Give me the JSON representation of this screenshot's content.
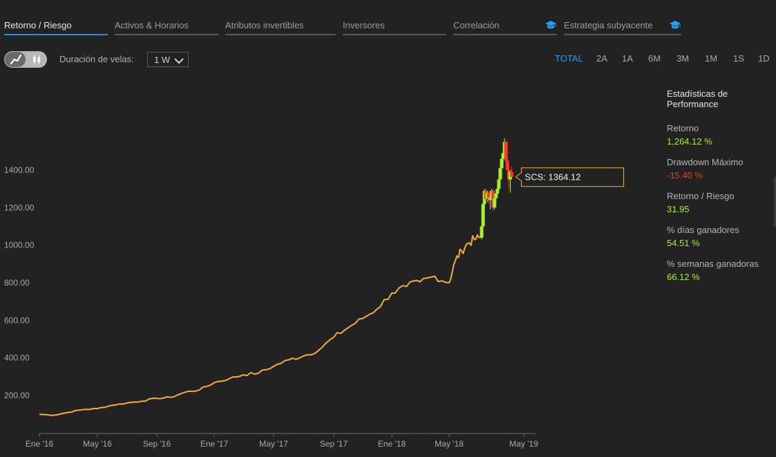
{
  "tabs": [
    {
      "label": "Retorno / Riesgo",
      "active": true
    },
    {
      "label": "Activos & Horarios"
    },
    {
      "label": "Atributos invertibles"
    },
    {
      "label": "Inversores"
    },
    {
      "label": "Correlación",
      "icon": "graduation-cap-icon"
    },
    {
      "label": "Estrategia subyacente",
      "icon": "graduation-cap-icon"
    }
  ],
  "toolbar": {
    "chart_toggle": {
      "options": [
        "line-chart-icon",
        "candlestick-icon"
      ],
      "selected": "line-chart-icon"
    },
    "duration_label": "Duración de velas:",
    "duration_value": "1 W",
    "ranges": [
      "TOTAL",
      "2A",
      "1A",
      "6M",
      "3M",
      "1M",
      "1S",
      "1D"
    ],
    "active_range": "TOTAL"
  },
  "colors": {
    "background": "#222222",
    "line": "#f5ad38",
    "candle_up": "#a6f02c",
    "candle_down": "#f23c2c",
    "tooltip_border": "#e8b84a",
    "active_tab": "#1e90e0"
  },
  "tooltip": {
    "label": "SCS: 1364.12"
  },
  "stats": {
    "title": "Estadísticas de Performance",
    "items": [
      {
        "label": "Retorno",
        "value": "1,264.12 %",
        "sign": "pos"
      },
      {
        "label": "Drawdown Máximo",
        "value": "-15.40 %",
        "sign": "neg"
      },
      {
        "label": "Retorno / Riesgo",
        "value": "31.95",
        "sign": "pos"
      },
      {
        "label": "% días ganadores",
        "value": "54.51 %",
        "sign": "pos"
      },
      {
        "label": "% semanas ganadoras",
        "value": "66.12 %",
        "sign": "pos"
      }
    ]
  },
  "chart_data": {
    "type": "line",
    "series_label": "SCS",
    "x_ticks": [
      "Ene '16",
      "May '16",
      "Sep '16",
      "Ene '17",
      "May '17",
      "Sep '17",
      "Ene '18",
      "May '18",
      "May '19"
    ],
    "y_ticks": [
      200,
      400,
      600,
      800,
      1000,
      1200,
      1400
    ],
    "y_tick_labels": [
      "200.00",
      "400.00",
      "600.00",
      "800.00",
      "1000.00",
      "1200.00",
      "1400.00"
    ],
    "ylim": [
      50,
      1600
    ],
    "xlim": [
      "2016-01-01",
      "2019-06-01"
    ],
    "line_points": [
      [
        "2016-01-01",
        100
      ],
      [
        "2016-02-01",
        95
      ],
      [
        "2016-03-01",
        110
      ],
      [
        "2016-04-01",
        125
      ],
      [
        "2016-05-01",
        130
      ],
      [
        "2016-06-01",
        148
      ],
      [
        "2016-07-01",
        160
      ],
      [
        "2016-08-01",
        170
      ],
      [
        "2016-09-01",
        185
      ],
      [
        "2016-10-01",
        190
      ],
      [
        "2016-11-01",
        218
      ],
      [
        "2016-12-01",
        230
      ],
      [
        "2017-01-01",
        268
      ],
      [
        "2017-02-01",
        290
      ],
      [
        "2017-03-01",
        310
      ],
      [
        "2017-04-01",
        320
      ],
      [
        "2017-05-01",
        355
      ],
      [
        "2017-06-01",
        390
      ],
      [
        "2017-07-01",
        410
      ],
      [
        "2017-08-01",
        440
      ],
      [
        "2017-09-01",
        510
      ],
      [
        "2017-10-01",
        560
      ],
      [
        "2017-11-01",
        610
      ],
      [
        "2017-12-01",
        660
      ],
      [
        "2018-01-01",
        745
      ],
      [
        "2018-02-01",
        780
      ],
      [
        "2018-03-01",
        805
      ],
      [
        "2018-04-01",
        835
      ],
      [
        "2018-05-01",
        800
      ],
      [
        "2018-06-01",
        920
      ],
      [
        "2018-07-01",
        970
      ],
      [
        "2018-08-01",
        1010
      ],
      [
        "2018-09-01",
        1030
      ],
      [
        "2018-10-01",
        1040
      ]
    ],
    "candles": [
      [
        "2018-10-07",
        1040,
        1110,
        1030,
        1100
      ],
      [
        "2018-10-14",
        1100,
        1230,
        1090,
        1220
      ],
      [
        "2018-10-21",
        1220,
        1300,
        1200,
        1290
      ],
      [
        "2018-10-28",
        1290,
        1300,
        1230,
        1245
      ],
      [
        "2018-11-04",
        1245,
        1290,
        1230,
        1280
      ],
      [
        "2018-11-11",
        1280,
        1290,
        1220,
        1240
      ],
      [
        "2018-11-18",
        1240,
        1270,
        1190,
        1255
      ],
      [
        "2018-11-25",
        1255,
        1300,
        1240,
        1290
      ],
      [
        "2018-12-02",
        1290,
        1300,
        1180,
        1200
      ],
      [
        "2018-12-09",
        1200,
        1260,
        1190,
        1250
      ],
      [
        "2018-12-16",
        1250,
        1280,
        1230,
        1275
      ],
      [
        "2018-12-23",
        1275,
        1310,
        1260,
        1300
      ],
      [
        "2018-12-30",
        1300,
        1360,
        1290,
        1350
      ],
      [
        "2019-01-06",
        1350,
        1420,
        1340,
        1410
      ],
      [
        "2019-01-13",
        1410,
        1470,
        1390,
        1460
      ],
      [
        "2019-01-20",
        1460,
        1500,
        1430,
        1490
      ],
      [
        "2019-01-27",
        1490,
        1570,
        1470,
        1550
      ],
      [
        "2019-02-03",
        1550,
        1555,
        1420,
        1450
      ],
      [
        "2019-02-10",
        1450,
        1470,
        1360,
        1400
      ],
      [
        "2019-02-17",
        1400,
        1430,
        1300,
        1350
      ],
      [
        "2019-02-24",
        1350,
        1400,
        1280,
        1390
      ],
      [
        "2019-03-03",
        1390,
        1420,
        1360,
        1364
      ]
    ]
  }
}
